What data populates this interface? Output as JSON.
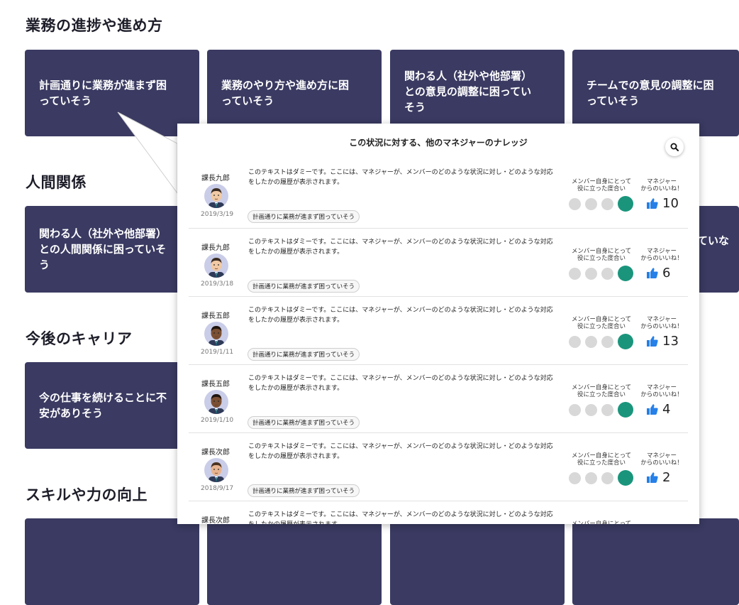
{
  "sections": [
    {
      "title": "業務の進捗や進め方",
      "cards": [
        {
          "lines": [
            "計画通りに業務が進まず困",
            "っていそう"
          ]
        },
        {
          "lines": [
            "業務のやり方や進め方に困",
            "っていそう"
          ]
        },
        {
          "lines": [
            "関わる人（社外や他部署）",
            "との意見の調整に困ってい",
            "そう"
          ]
        },
        {
          "lines": [
            "チームでの意見の調整に困",
            "っていそう"
          ]
        }
      ]
    },
    {
      "title": "人間関係",
      "cards": [
        {
          "lines": [
            "関わる人（社外や他部署）",
            "との人間関係に困っていそ",
            "う"
          ]
        },
        {
          "lines": [
            "ていな"
          ]
        }
      ]
    },
    {
      "title": "今後のキャリア",
      "cards": [
        {
          "lines": [
            "今の仕事を続けることに不",
            "安がありそう"
          ]
        }
      ]
    },
    {
      "title": "スキルや力の向上",
      "cards": []
    }
  ],
  "panel": {
    "title": "この状況に対する、他のマネジャーのナレッジ",
    "search_icon": "search-icon",
    "rating_label": [
      "メンバー自身にとって",
      "役に立った度合い"
    ],
    "like_label": [
      "マネジャー",
      "からのいいね！"
    ],
    "body_line1": "このテキストはダミーです。ここには、マネジャーが、メンバーのどのような状況に対し・どのような対応",
    "body_line2": "をしたかの履歴が表示されます。",
    "tag": "計画通りに業務が進まず困っていそう",
    "entries": [
      {
        "manager": "課長九郎",
        "date": "2019/3/19",
        "likes": "10",
        "skin": "#f1c9a4",
        "hair": "#3b2c22"
      },
      {
        "manager": "課長九郎",
        "date": "2019/3/18",
        "likes": "6",
        "skin": "#f1c9a4",
        "hair": "#3b2c22"
      },
      {
        "manager": "課長五郎",
        "date": "2019/1/11",
        "likes": "13",
        "skin": "#7a4f33",
        "hair": "#1e140e"
      },
      {
        "manager": "課長五郎",
        "date": "2019/1/10",
        "likes": "4",
        "skin": "#7a4f33",
        "hair": "#1e140e"
      },
      {
        "manager": "課長次郎",
        "date": "2018/9/17",
        "likes": "2",
        "skin": "#e7b48f",
        "hair": "#4a3320"
      },
      {
        "manager": "課長次郎",
        "date": "",
        "likes": "",
        "skin": "#e7b48f",
        "hair": "#4a3320"
      }
    ]
  },
  "colors": {
    "card": "#3a3a62",
    "rating_active": "#1a957c",
    "rating_inactive": "#d8d8d8",
    "like": "#2680e8"
  }
}
